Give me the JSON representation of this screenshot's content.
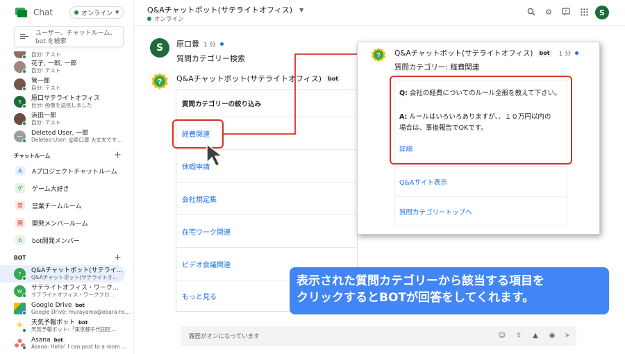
{
  "app": {
    "brand": "Chat",
    "status": "オンライン"
  },
  "search": {
    "placeholder": "ユーザー、チャットルーム、bot を検索"
  },
  "dms": [
    {
      "name": "",
      "sub": "自分: テスト",
      "color": "#8d6e63"
    },
    {
      "name": "花子, 一郎, 一郎",
      "sub": "自分: テスト",
      "color": "#a1887f"
    },
    {
      "name": "管一郎",
      "sub": "自分: テスト",
      "color": "#795548"
    },
    {
      "name": "原口サテライトオフィス",
      "sub": "自分: 画像を送信しました",
      "color": "#1e6b3a"
    },
    {
      "name": "浜田一郎",
      "sub": "自分: テスト",
      "color": "#6d4c41"
    },
    {
      "name": "Deleted User, 一郎",
      "sub": "Deleted User: @原口豊 大丈夫です…",
      "color": "#9e9e9e"
    }
  ],
  "rooms_title": "チャットルーム",
  "rooms": [
    {
      "label": "Aプロジェクトチャットルーム",
      "glyph": "A",
      "bg": "#e8f0fe",
      "fg": "#1a73e8"
    },
    {
      "label": "ゲーム大好き",
      "glyph": "ゲ",
      "bg": "#e6f4ea",
      "fg": "#1e8e3e"
    },
    {
      "label": "営業チームルーム",
      "glyph": "営",
      "bg": "#fce8e6",
      "fg": "#d93025"
    },
    {
      "label": "開発メンバールーム",
      "glyph": "開",
      "bg": "#fce8e6",
      "fg": "#d93025"
    },
    {
      "label": "bot開発メンバー",
      "glyph": "b",
      "bg": "#e6f4ea",
      "fg": "#1e8e3e"
    }
  ],
  "bots_title": "BOT",
  "bots": [
    {
      "name": "Q&Aチャットボット(サテライ…",
      "sub": "Q&Aチャットボット(サテライトオ…",
      "badge": "",
      "color": "#34a853"
    },
    {
      "name": "サテライトオフィス・ワーク…",
      "sub": "サテライトオフィス・ワークフロ…",
      "badge": "",
      "color": "#34a853"
    },
    {
      "name": "Google Drive",
      "sub": "Google Drive: murayama@ebara-hs…",
      "badge": "bot",
      "color": "#fbbc04"
    },
    {
      "name": "天気予報ボット",
      "sub": "天気予報ボット:「東京都千代田区…",
      "badge": "bot",
      "color": "#fbbc04"
    },
    {
      "name": "Asana",
      "sub": "Asana: Hello! I can post to a room …",
      "badge": "bot",
      "color": "#f06a6a"
    }
  ],
  "header": {
    "title": "Q&Aチャットボット(サテライトオフィス)",
    "status": "オンライン"
  },
  "messages": {
    "user_name": "原口豊",
    "user_time": "1 分",
    "user_text": "質問カテゴリー検索",
    "bot_name": "Q&Aチャットボット(サテライトオフィス)",
    "bot_badge": "bot"
  },
  "card": {
    "header": "質問カテゴリーの絞り込み",
    "items": [
      "経費関連",
      "休暇申請",
      "会社規定集",
      "在宅ワーク関連",
      "ビデオ会議関連",
      "もっと見る"
    ]
  },
  "overlay": {
    "bot_name": "Q&Aチャットボット(サテライトオフィス)",
    "badge": "bot",
    "time": "1 分",
    "category": "質問カテゴリー: 経費関連",
    "q_label": "Q:",
    "q_text": "会社の経費についてのルール全般を教えて下さい。",
    "a_label": "A:",
    "a_text_1": "ルールはいろいろありますが、、１０万円以内の",
    "a_text_2": "場合は、事後報告でOKです。",
    "detail_link": "詳細",
    "site_link": "Q&Aサイト表示",
    "top_link": "質問カテゴリートップへ"
  },
  "composer": {
    "placeholder": "履歴がオンになっています"
  },
  "callout": {
    "line1": "表示された質問カテゴリーから該当する項目を",
    "line2": "クリックするとBOTが回答をしてくれます。"
  },
  "colors": {
    "accent": "#1a73e8",
    "highlight": "#d93025",
    "callout": "#4285f4",
    "online": "#1e8e3e"
  }
}
